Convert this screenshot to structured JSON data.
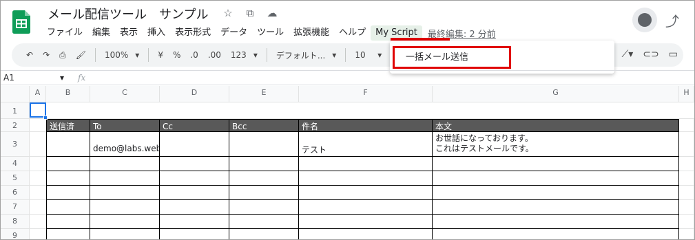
{
  "doc": {
    "title": "メール配信ツール　サンプル"
  },
  "title_icons": [
    "star-icon",
    "move-folder-icon",
    "cloud-status-icon"
  ],
  "menu": [
    "ファイル",
    "編集",
    "表示",
    "挿入",
    "表示形式",
    "データ",
    "ツール",
    "拡張機能",
    "ヘルプ",
    "My Script"
  ],
  "last_edit": "最終編集: 2 分前",
  "toolbar": {
    "zoom": "100%",
    "currency": "¥",
    "percent": "%",
    "decimal_decrease": ".0",
    "decimal_increase": ".00",
    "format_more": "123",
    "font": "デフォルト...",
    "font_size": "10"
  },
  "popup": {
    "item": "一括メール送信"
  },
  "formula": {
    "cell_ref": "A1",
    "fx": "fx"
  },
  "columns": [
    "A",
    "B",
    "C",
    "D",
    "E",
    "F",
    "G",
    "H"
  ],
  "rows": [
    "1",
    "2",
    "3",
    "4",
    "5",
    "6",
    "7",
    "8",
    "9"
  ],
  "table": {
    "headers": [
      "送信済",
      "To",
      "Cc",
      "Bcc",
      "件名",
      "本文"
    ],
    "rows": [
      [
        "",
        "demo@labs.web-dsk.net",
        "",
        "",
        "テスト",
        "お世話になっております。\nこれはテストメールです。"
      ],
      [
        "",
        "",
        "",
        "",
        "",
        ""
      ],
      [
        "",
        "",
        "",
        "",
        "",
        ""
      ],
      [
        "",
        "",
        "",
        "",
        "",
        ""
      ],
      [
        "",
        "",
        "",
        "",
        "",
        ""
      ],
      [
        "",
        "",
        "",
        "",
        "",
        ""
      ],
      [
        "",
        "",
        "",
        "",
        "",
        ""
      ]
    ]
  },
  "colors": {
    "header_bg": "#595959",
    "highlight": "#e00000",
    "selection": "#1a73e8",
    "sheets_green": "#0f9d58"
  }
}
